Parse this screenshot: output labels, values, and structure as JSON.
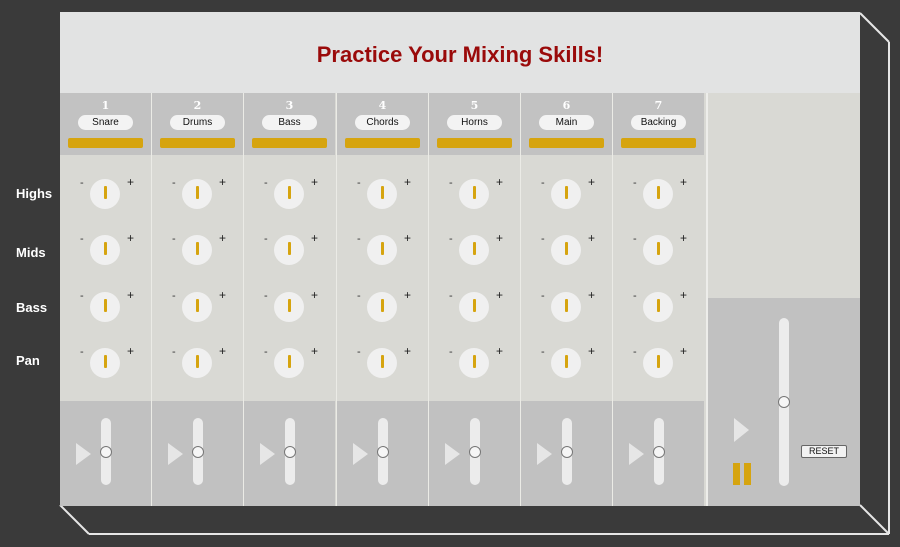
{
  "title": "Practice Your Mixing Skills!",
  "row_labels": [
    "Highs",
    "Mids",
    "Bass",
    "Pan"
  ],
  "knob_minus": "-",
  "knob_plus": "+",
  "channels": [
    {
      "number": "1",
      "name": "Snare"
    },
    {
      "number": "2",
      "name": "Drums"
    },
    {
      "number": "3",
      "name": "Bass"
    },
    {
      "number": "4",
      "name": "Chords"
    },
    {
      "number": "5",
      "name": "Horns"
    },
    {
      "number": "6",
      "name": "Main"
    },
    {
      "number": "7",
      "name": "Backing"
    }
  ],
  "channel_fader_level": 0.5,
  "master": {
    "reset_label": "RESET",
    "fader_level": 0.5
  },
  "colors": {
    "accent": "#d6a40f",
    "title": "#9a0a0a",
    "background": "#3a3a3a"
  },
  "icons": {
    "play": "play-icon",
    "pause": "pause-icon"
  }
}
